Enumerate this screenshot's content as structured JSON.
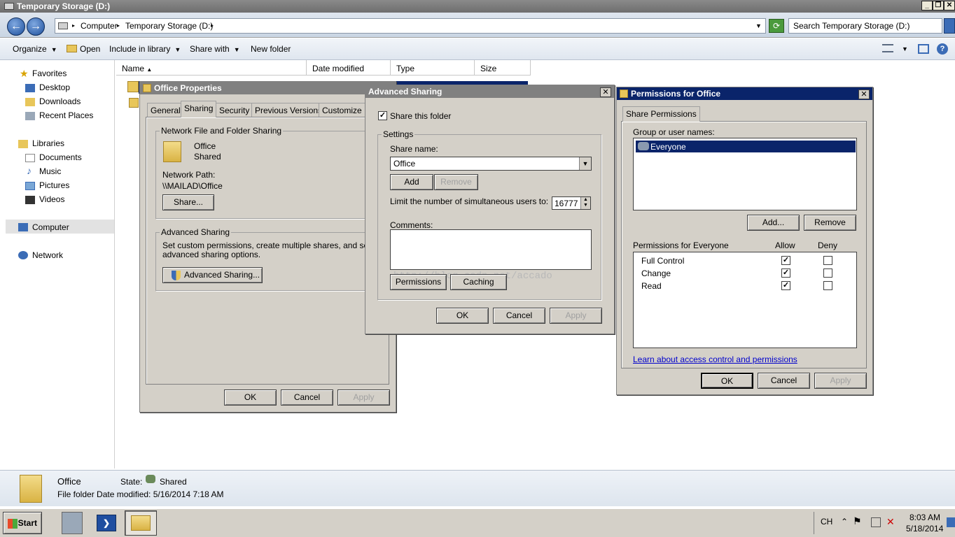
{
  "window": {
    "title": "Temporary Storage (D:)"
  },
  "address": {
    "crumbs": [
      "Computer",
      "Temporary Storage (D:)"
    ],
    "search_placeholder": "Search Temporary Storage (D:)"
  },
  "toolbar": {
    "organize": "Organize",
    "open": "Open",
    "include": "Include in library",
    "share_with": "Share with",
    "new_folder": "New folder"
  },
  "nav": {
    "favorites": "Favorites",
    "desktop": "Desktop",
    "downloads": "Downloads",
    "recent": "Recent Places",
    "libraries": "Libraries",
    "documents": "Documents",
    "music": "Music",
    "pictures": "Pictures",
    "videos": "Videos",
    "computer": "Computer",
    "network": "Network"
  },
  "columns": {
    "name": "Name",
    "date": "Date modified",
    "type": "Type",
    "size": "Size"
  },
  "props": {
    "title": "Office Properties",
    "tabs": [
      "General",
      "Sharing",
      "Security",
      "Previous Versions",
      "Customize"
    ],
    "nffs_group": "Network File and Folder Sharing",
    "folder_name": "Office",
    "folder_state": "Shared",
    "netpath_label": "Network Path:",
    "netpath": "\\\\MAILAD\\Office",
    "share_btn": "Share...",
    "adv_group": "Advanced Sharing",
    "adv_desc1": "Set custom permissions, create multiple shares, and set other",
    "adv_desc2": "advanced sharing options.",
    "adv_btn": "Advanced Sharing...",
    "ok": "OK",
    "cancel": "Cancel",
    "apply": "Apply"
  },
  "adv": {
    "title": "Advanced Sharing",
    "share_this": "Share this folder",
    "settings": "Settings",
    "share_name_label": "Share name:",
    "share_name": "Office",
    "add": "Add",
    "remove": "Remove",
    "limit_label": "Limit the number of simultaneous users to:",
    "limit_value": "16777",
    "comments": "Comments:",
    "permissions": "Permissions",
    "caching": "Caching",
    "watermark": "http://blog.csdn.net/accado",
    "ok": "OK",
    "cancel": "Cancel",
    "apply": "Apply"
  },
  "perm": {
    "title": "Permissions for Office",
    "tab": "Share Permissions",
    "group_label": "Group or user names:",
    "user": "Everyone",
    "add": "Add...",
    "remove": "Remove",
    "for_label": "Permissions for Everyone",
    "allow": "Allow",
    "deny": "Deny",
    "rows": [
      {
        "name": "Full Control",
        "allow": true,
        "deny": false
      },
      {
        "name": "Change",
        "allow": true,
        "deny": false
      },
      {
        "name": "Read",
        "allow": true,
        "deny": false
      }
    ],
    "learn": "Learn about access control and permissions",
    "ok": "OK",
    "cancel": "Cancel",
    "apply": "Apply"
  },
  "details": {
    "name": "Office",
    "state_label": "State:",
    "state": "Shared",
    "meta": "File folder Date modified: 5/16/2014 7:18 AM"
  },
  "taskbar": {
    "start": "Start",
    "lang": "CH",
    "time": "8:03 AM",
    "date": "5/18/2014"
  }
}
